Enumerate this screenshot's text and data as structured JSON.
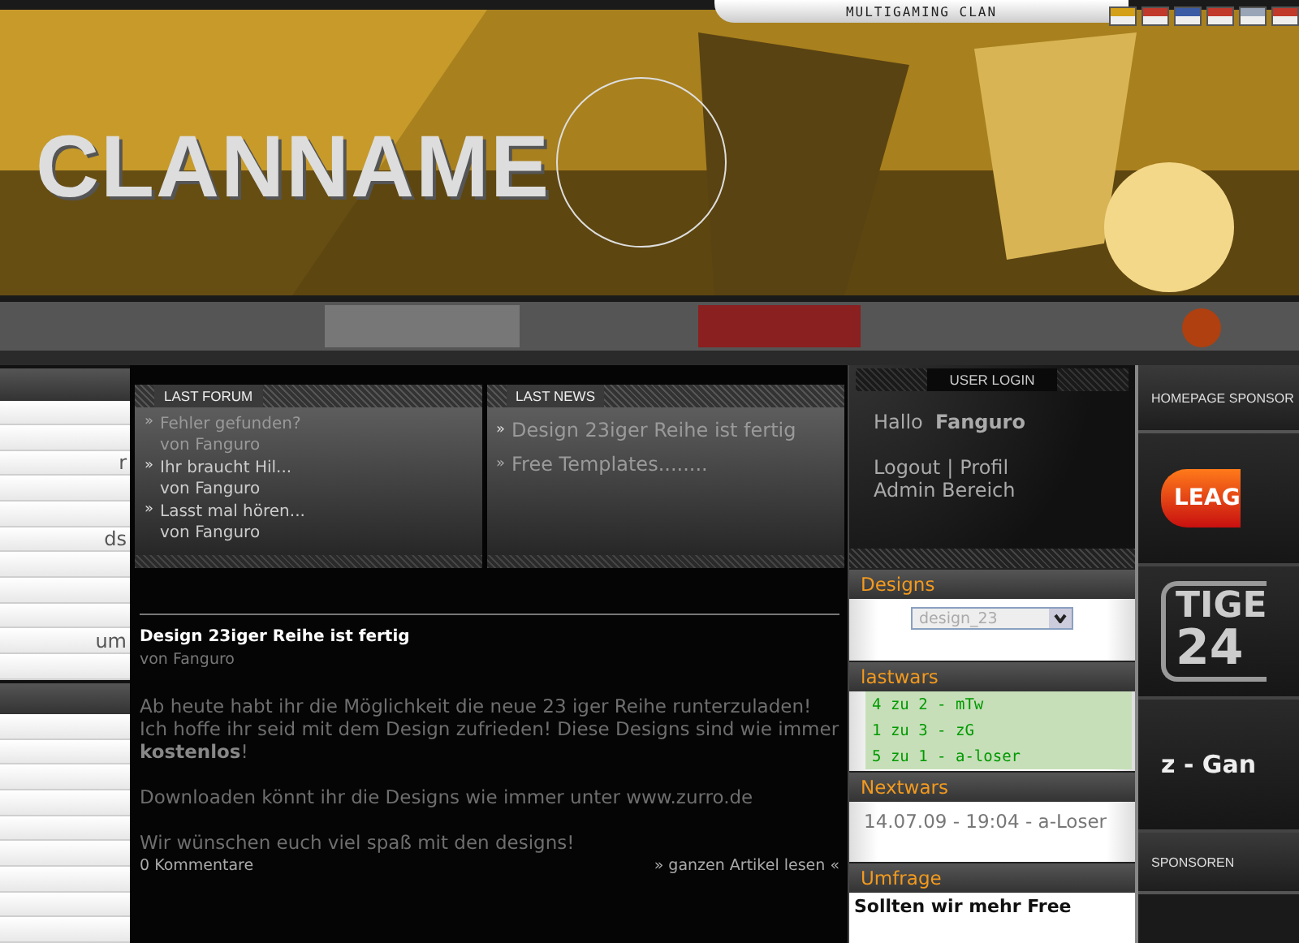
{
  "header": {
    "logo": "CLANNAME",
    "tagline": "MULTIGAMING CLAN",
    "flags": [
      {
        "color": "#d4a017"
      },
      {
        "color": "#c0392b"
      },
      {
        "color": "#3b5ba5"
      },
      {
        "color": "#c0392b"
      },
      {
        "color": "#9aa6b8"
      },
      {
        "color": "#c0392b"
      }
    ]
  },
  "sidebar": {
    "sections": [
      {
        "items": [
          {
            "kind": "blank"
          },
          {
            "kind": "blank"
          },
          {
            "kind": "text",
            "label": "r"
          },
          {
            "kind": "blank"
          },
          {
            "kind": "blank"
          },
          {
            "kind": "text",
            "label": "ds"
          },
          {
            "kind": "blank"
          },
          {
            "kind": "blank"
          },
          {
            "kind": "blank"
          },
          {
            "kind": "text",
            "label": "um"
          },
          {
            "kind": "blank"
          }
        ]
      },
      {
        "items": [
          {
            "kind": "blank"
          },
          {
            "kind": "blank"
          },
          {
            "kind": "blank"
          },
          {
            "kind": "blank"
          },
          {
            "kind": "blank"
          },
          {
            "kind": "blank"
          },
          {
            "kind": "blank"
          },
          {
            "kind": "blank"
          },
          {
            "kind": "blank"
          }
        ]
      }
    ]
  },
  "bullet": "»",
  "last_forum": {
    "title": "LAST FORUM",
    "items": [
      {
        "topic": "Fehler gefunden?",
        "author": "von Fanguro",
        "dim": true
      },
      {
        "topic": "Ihr braucht Hil...",
        "author": "von Fanguro",
        "dim": false
      },
      {
        "topic": "Lasst mal hören...",
        "author": "von Fanguro",
        "dim": false
      }
    ]
  },
  "last_news": {
    "title": "LAST NEWS",
    "items": [
      "Design 23iger Reihe ist fertig",
      "Free Templates........"
    ]
  },
  "article": {
    "title": "Design 23iger Reihe ist fertig",
    "author": "von Fanguro",
    "paragraphs": [
      "Ab heute habt ihr die Möglichkeit die neue 23 iger Reihe runterzuladen! Ich hoffe ihr seid mit dem Design zufrieden! Diese Designs sind wie immer **kostenlos**!",
      "Downloaden könnt ihr die Designs wie immer unter www.zurro.de",
      "Wir wünschen euch viel spaß mit den designs!"
    ],
    "comments": "0 Kommentare",
    "read_more": "ganzen Artikel lesen",
    "read_more_left": "»",
    "read_more_right": "«"
  },
  "user_login": {
    "title": "USER LOGIN",
    "greeting": "Hallo",
    "user": "Fanguro",
    "links": [
      "Logout",
      "Profil"
    ],
    "separator": "|",
    "admin": "Admin Bereich"
  },
  "designs": {
    "title": "Designs",
    "select_value": "design_23"
  },
  "lastwars": {
    "title": "lastwars",
    "items": [
      "4 zu 2 - mTw",
      "1 zu 3 - zG",
      "5 zu 1 - a-loser"
    ]
  },
  "nextwars": {
    "title": "Nextwars",
    "items": [
      "14.07.09 - 19:04 - a-Loser"
    ]
  },
  "umfrage": {
    "title": "Umfrage",
    "question": "Sollten wir mehr Free"
  },
  "sponsors": {
    "title": "HOMEPAGE SPONSOR",
    "logos": [
      {
        "kind": "league",
        "text": "LEAG"
      },
      {
        "kind": "tiger",
        "text": "TIGE",
        "text2": "24"
      },
      {
        "kind": "zgame",
        "text": "z - Gan"
      }
    ],
    "title2": "SPONSOREN"
  }
}
